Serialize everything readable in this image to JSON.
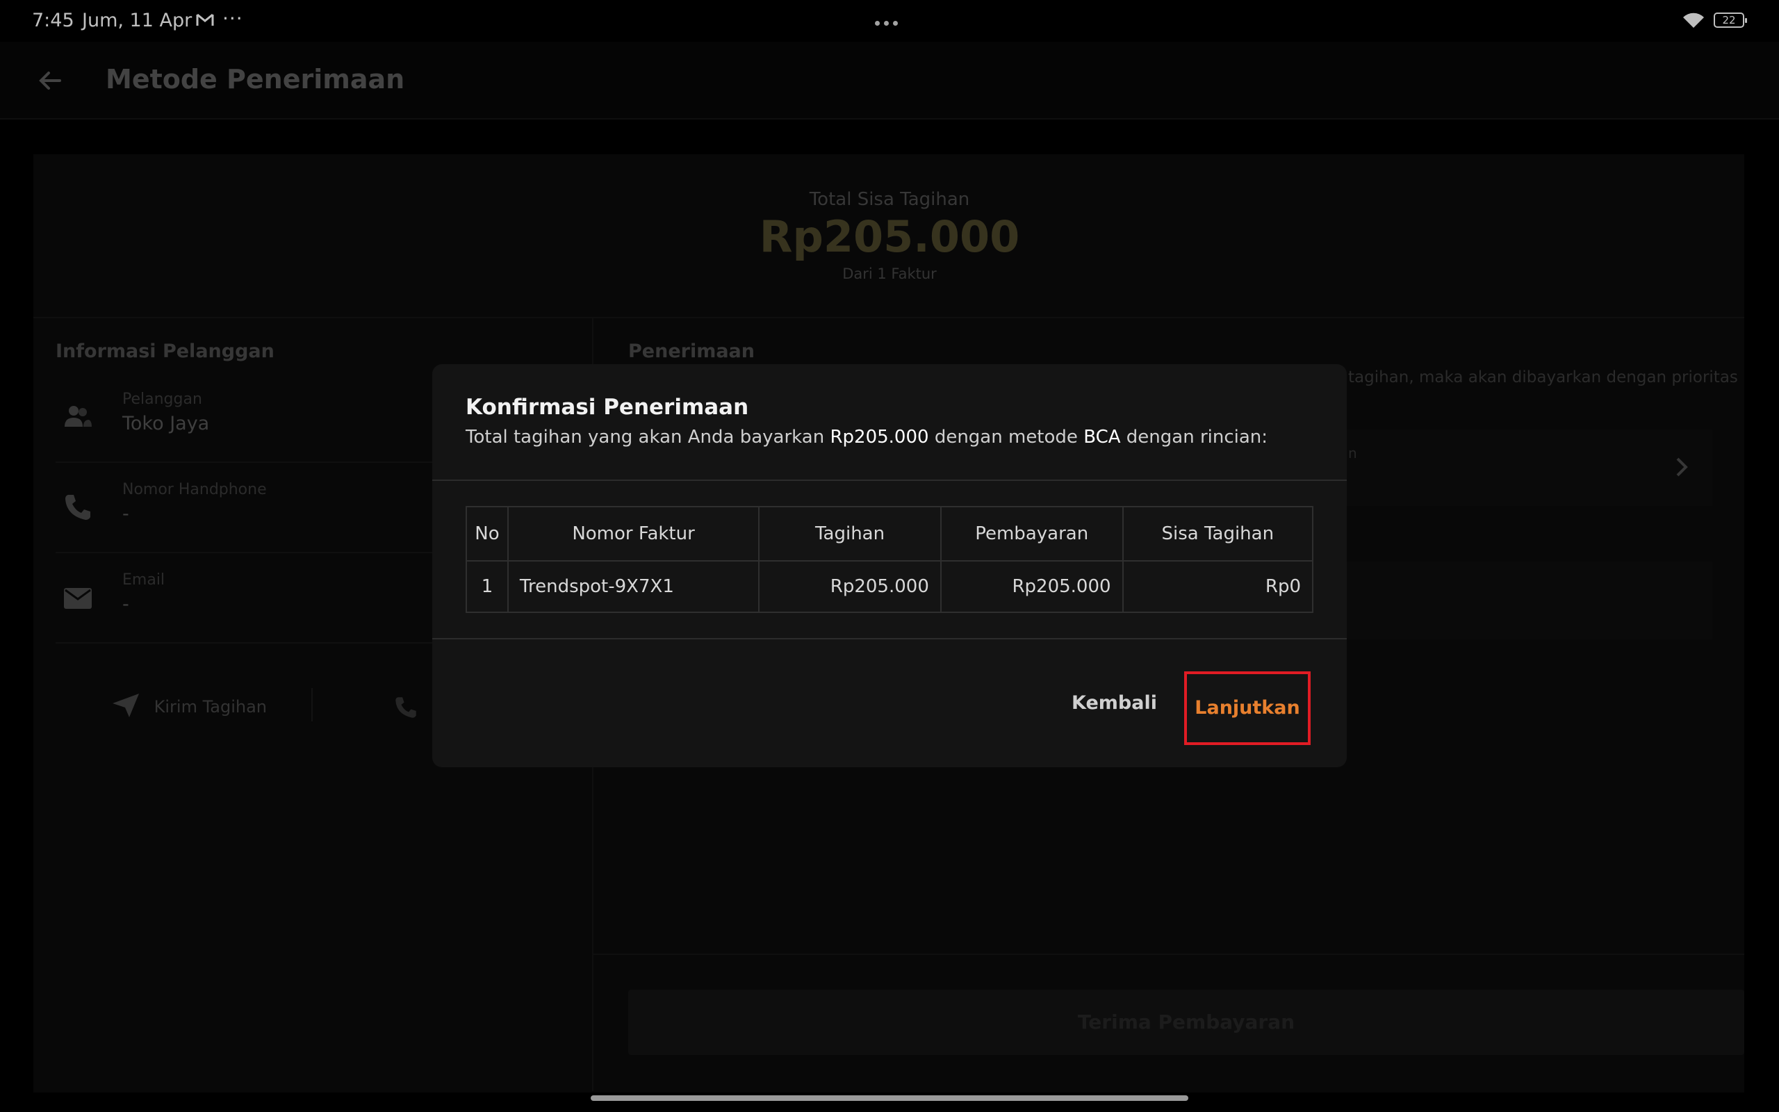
{
  "status_bar": {
    "time": "7:45",
    "date": "Jum, 11 Apr",
    "more": "···",
    "battery": "22"
  },
  "app_bar": {
    "title": "Metode Penerimaan"
  },
  "summary": {
    "label": "Total Sisa Tagihan",
    "amount": "Rp205.000",
    "sub": "Dari 1 Faktur"
  },
  "customer": {
    "title": "Informasi Pelanggan",
    "rows": [
      {
        "label": "Pelanggan",
        "value": "Toko Jaya"
      },
      {
        "label": "Nomor Handphone",
        "value": "-"
      },
      {
        "label": "Email",
        "value": "-"
      }
    ],
    "send_label": "Kirim Tagihan"
  },
  "penerimaan": {
    "title": "Penerimaan",
    "note": "tagihan, maka akan dibayarkan dengan prioritas",
    "card_stub": "n",
    "accept_button": "Terima Pembayaran"
  },
  "dialog": {
    "title": "Konfirmasi Penerimaan",
    "desc_pre": "Total tagihan yang akan Anda bayarkan ",
    "desc_amount": "Rp205.000",
    "desc_mid": " dengan metode ",
    "desc_method": "BCA",
    "desc_post": " dengan rincian:",
    "table": {
      "headers": [
        "No",
        "Nomor Faktur",
        "Tagihan",
        "Pembayaran",
        "Sisa Tagihan"
      ],
      "rows": [
        [
          "1",
          "Trendspot-9X7X1",
          "Rp205.000",
          "Rp205.000",
          "Rp0"
        ]
      ]
    },
    "back_label": "Kembali",
    "next_label": "Lanjutkan"
  },
  "colors": {
    "accent": "#e8802e",
    "highlight_box": "#e11c24"
  }
}
